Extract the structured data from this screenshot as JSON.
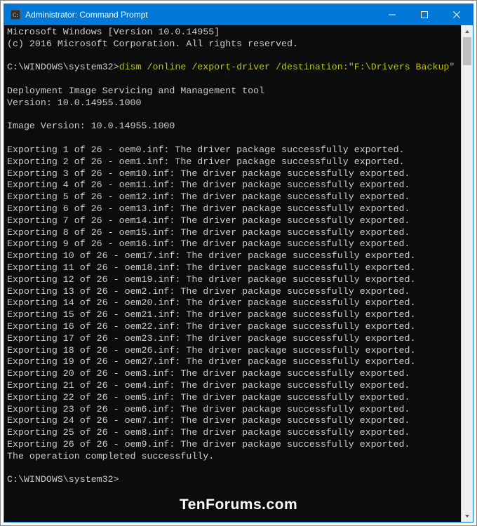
{
  "titlebar": {
    "icon_label": "cmd-admin-icon",
    "title": "Administrator: Command Prompt",
    "minimize": "—",
    "maximize": "☐",
    "close": "✕"
  },
  "banner": {
    "line1": "Microsoft Windows [Version 10.0.14955]",
    "line2": "(c) 2016 Microsoft Corporation. All rights reserved."
  },
  "prompt1": {
    "prefix": "C:\\WINDOWS\\system32>",
    "cmd_part": "dism /online /export-driver /destination:",
    "quote1": "\"",
    "path": "F:\\Drivers Backup",
    "quote2": "\""
  },
  "tool": {
    "line1": "Deployment Image Servicing and Management tool",
    "line2": "Version: 10.0.14955.1000",
    "line3": "Image Version: 10.0.14955.1000"
  },
  "exports": [
    {
      "text": "Exporting 1 of 26 - oem0.inf: The driver package successfully exported."
    },
    {
      "text": "Exporting 2 of 26 - oem1.inf: The driver package successfully exported."
    },
    {
      "text": "Exporting 3 of 26 - oem10.inf: The driver package successfully exported."
    },
    {
      "text": "Exporting 4 of 26 - oem11.inf: The driver package successfully exported."
    },
    {
      "text": "Exporting 5 of 26 - oem12.inf: The driver package successfully exported."
    },
    {
      "text": "Exporting 6 of 26 - oem13.inf: The driver package successfully exported."
    },
    {
      "text": "Exporting 7 of 26 - oem14.inf: The driver package successfully exported."
    },
    {
      "text": "Exporting 8 of 26 - oem15.inf: The driver package successfully exported."
    },
    {
      "text": "Exporting 9 of 26 - oem16.inf: The driver package successfully exported."
    },
    {
      "text": "Exporting 10 of 26 - oem17.inf: The driver package successfully exported."
    },
    {
      "text": "Exporting 11 of 26 - oem18.inf: The driver package successfully exported."
    },
    {
      "text": "Exporting 12 of 26 - oem19.inf: The driver package successfully exported."
    },
    {
      "text": "Exporting 13 of 26 - oem2.inf: The driver package successfully exported."
    },
    {
      "text": "Exporting 14 of 26 - oem20.inf: The driver package successfully exported."
    },
    {
      "text": "Exporting 15 of 26 - oem21.inf: The driver package successfully exported."
    },
    {
      "text": "Exporting 16 of 26 - oem22.inf: The driver package successfully exported."
    },
    {
      "text": "Exporting 17 of 26 - oem23.inf: The driver package successfully exported."
    },
    {
      "text": "Exporting 18 of 26 - oem26.inf: The driver package successfully exported."
    },
    {
      "text": "Exporting 19 of 26 - oem27.inf: The driver package successfully exported."
    },
    {
      "text": "Exporting 20 of 26 - oem3.inf: The driver package successfully exported."
    },
    {
      "text": "Exporting 21 of 26 - oem4.inf: The driver package successfully exported."
    },
    {
      "text": "Exporting 22 of 26 - oem5.inf: The driver package successfully exported."
    },
    {
      "text": "Exporting 23 of 26 - oem6.inf: The driver package successfully exported."
    },
    {
      "text": "Exporting 24 of 26 - oem7.inf: The driver package successfully exported."
    },
    {
      "text": "Exporting 25 of 26 - oem8.inf: The driver package successfully exported."
    },
    {
      "text": "Exporting 26 of 26 - oem9.inf: The driver package successfully exported."
    }
  ],
  "complete": "The operation completed successfully.",
  "prompt2": {
    "prefix": "C:\\WINDOWS\\system32>"
  },
  "watermark": "TenForums.com"
}
